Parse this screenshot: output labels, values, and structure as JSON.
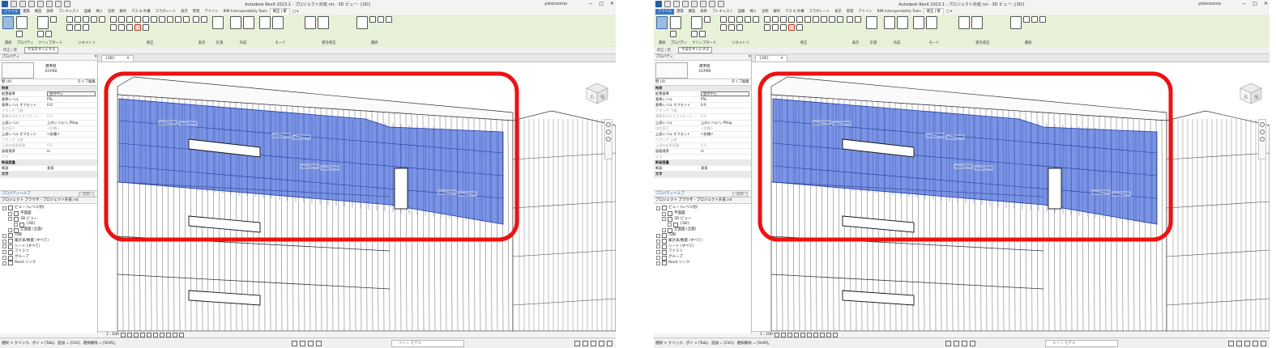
{
  "app": {
    "title": "Autodesk Revit 2023.1 - プロジェクト外皮.rvt - 3D ビュー: {3D}",
    "user": "yotenzomo"
  },
  "ribbon": {
    "tabs": [
      "ファイル",
      "建築",
      "構造",
      "鉄骨",
      "プレキャスト",
      "設備",
      "挿入",
      "注釈",
      "解析",
      "マス & 外構",
      "コラボレート",
      "表示",
      "管理",
      "アドイン",
      "BIM Interoperability Tools",
      "修正 | 壁",
      "□ ▾"
    ],
    "groups": [
      "選択",
      "プロパティ",
      "クリップボード",
      "ジオメトリ",
      "修正",
      "表示",
      "計測",
      "作成",
      "モード",
      "壁を修正",
      "選択"
    ],
    "options": {
      "context": "修正 | 壁",
      "button": "寸法をオンにする"
    }
  },
  "properties": {
    "header": "プロパティ",
    "type_name": "標準壁",
    "type_sub": "ECP60",
    "selector": "壁 (4)",
    "edit_type": "タイプ編集",
    "rows": [
      {
        "k": "拘束",
        "v": "",
        "cat": true
      },
      {
        "k": "配置基準",
        "v": "壁の中心",
        "box": true
      },
      {
        "k": "基準レベル",
        "v": "P5L"
      },
      {
        "k": "基準レベル オフセット",
        "v": "0.0"
      },
      {
        "k": "アタッチ 下端",
        "v": "",
        "dim": true
      },
      {
        "k": "基準を外れたオフセット",
        "v": "0.0",
        "dim": true
      },
      {
        "k": "上部レベル",
        "v": "上のレベルへ: Pltop"
      },
      {
        "k": "指定高さ",
        "v": "<各種>",
        "dim": true
      },
      {
        "k": "上部レベル オフセット",
        "v": "<各種>"
      },
      {
        "k": "アタッチ 上端",
        "v": "",
        "dim": true
      },
      {
        "k": "上部の拡張距離",
        "v": "0.0",
        "dim": true
      },
      {
        "k": "部屋境界",
        "v": "☑"
      },
      {
        "k": "マス",
        "v": "",
        "dim": true
      },
      {
        "k": "断面度量",
        "v": "",
        "cat": true
      },
      {
        "k": "断面",
        "v": "垂直"
      },
      {
        "k": "文字",
        "v": "",
        "cat": true
      }
    ],
    "help_link": "プロパティヘルプ",
    "apply": "適用"
  },
  "browser": {
    "header": "プロジェクト ブラウザ - プロジェクト外皮.rvt",
    "items": [
      {
        "label": "ビュー (レベル別)",
        "depth": 0
      },
      {
        "label": "平面図",
        "depth": 1
      },
      {
        "label": "3D ビュー",
        "depth": 1
      },
      {
        "label": "{3D}",
        "depth": 2
      },
      {
        "label": "立面図 (立面)",
        "depth": 1
      },
      {
        "label": "凡例",
        "depth": 0
      },
      {
        "label": "集計表/数量 (すべて)",
        "depth": 0
      },
      {
        "label": "シート (すべて)",
        "depth": 0
      },
      {
        "label": "ファミリ",
        "depth": 0
      },
      {
        "label": "グループ",
        "depth": 0
      },
      {
        "label": "Revit リンク",
        "depth": 0
      }
    ]
  },
  "view": {
    "tab": "{3D}",
    "scale": "1 : 100",
    "navcube_labels": [
      "右",
      "後"
    ]
  },
  "status": {
    "hint": "選択 + クリック、ポイ + [Tab]、追加 = [Ctrl]、選択解除 = [Shift]。",
    "model": "メイン モデル"
  },
  "colors": {
    "file_tab": "#3a76c4",
    "ribbon_bg": "#e6f1d8",
    "selection": "#3c62d8",
    "annotation_ring": "#ee1111"
  }
}
